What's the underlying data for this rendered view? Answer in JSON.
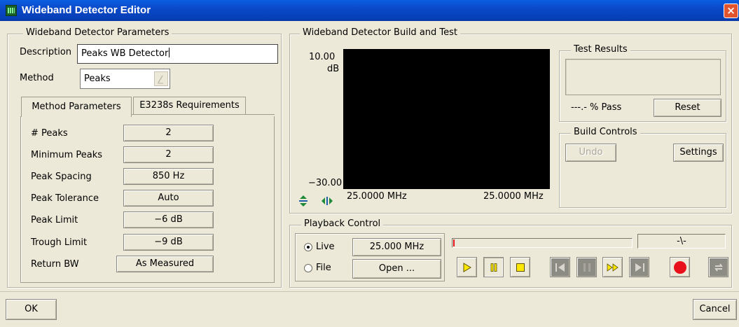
{
  "window": {
    "title": "Wideband Detector Editor",
    "close_glyph": "×"
  },
  "params": {
    "legend": "Wideband Detector Parameters",
    "description_label": "Description",
    "description_value": "Peaks WB Detector",
    "method_label": "Method",
    "method_value": "Peaks",
    "tabs": [
      "Method Parameters",
      "E3238s Requirements"
    ],
    "rows": [
      {
        "label": "# Peaks",
        "value": "2"
      },
      {
        "label": "Minimum Peaks",
        "value": "2"
      },
      {
        "label": "Peak Spacing",
        "value": "850 Hz"
      },
      {
        "label": "Peak Tolerance",
        "value": "Auto"
      },
      {
        "label": "Peak Limit",
        "value": "−6 dB"
      },
      {
        "label": "Trough Limit",
        "value": "−9 dB"
      },
      {
        "label": "Return BW",
        "value": "As Measured"
      }
    ]
  },
  "build_test": {
    "legend": "Wideband Detector Build and Test",
    "y_top": "10.00",
    "y_unit": "dB",
    "y_bottom": "−30.00",
    "x_left": "25.0000 MHz",
    "x_right": "25.0000 MHz"
  },
  "test_results": {
    "legend": "Test Results",
    "pass_text": "---.- % Pass",
    "reset_label": "Reset"
  },
  "build_controls": {
    "legend": "Build Controls",
    "undo_label": "Undo",
    "settings_label": "Settings"
  },
  "playback": {
    "legend": "Playback Control",
    "live_label": "Live",
    "live_value": "25.000 MHz",
    "file_label": "File",
    "open_label": "Open ...",
    "mode_indicator": "-\\-",
    "selected_source": "Live"
  },
  "footer": {
    "ok_label": "OK",
    "cancel_label": "Cancel"
  },
  "colors": {
    "title_bar": "#0a49c9",
    "record": "#e8101a",
    "play_icon": "#ffe800",
    "plot_bg": "#000000"
  }
}
